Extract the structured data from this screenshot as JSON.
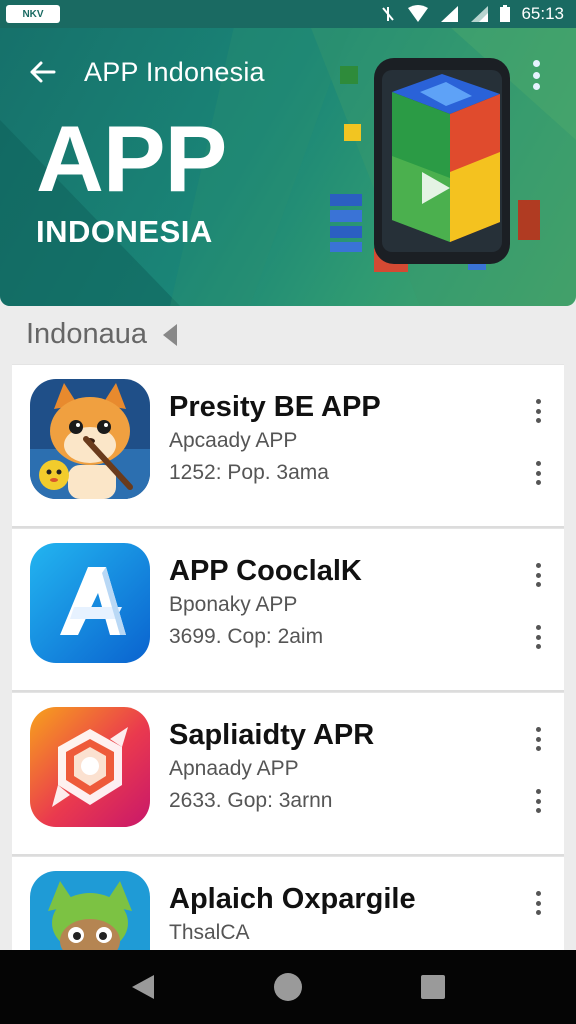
{
  "status_bar": {
    "logo_text": "NKV",
    "time": "65:13"
  },
  "header": {
    "title": "APP Indonesia",
    "hero_title": "APP",
    "hero_subtitle": "INDONESIA"
  },
  "section": {
    "label": "Indonaua"
  },
  "apps": [
    {
      "name": "Presity BE APP",
      "category": "Apcaady APP",
      "stats": "1252: Pop. 3ama",
      "icon": "fox-character-icon"
    },
    {
      "name": "APP CooclalK",
      "category": "Bponaky APP",
      "stats": "3699. Cop: 2aim",
      "icon": "letter-a-icon"
    },
    {
      "name": "Sapliaidty APR",
      "category": "Apnaady APP",
      "stats": "2633. Gop: 3arnn",
      "icon": "gem-badge-icon"
    },
    {
      "name": "Aplaich Oxpargile",
      "category": "ThsalCA",
      "stats": "",
      "icon": "goblin-character-icon"
    }
  ],
  "colors": {
    "header_start": "#16706a",
    "header_end": "#4ba868",
    "status_bar": "#1a6a62",
    "nav_bar": "#050505"
  }
}
